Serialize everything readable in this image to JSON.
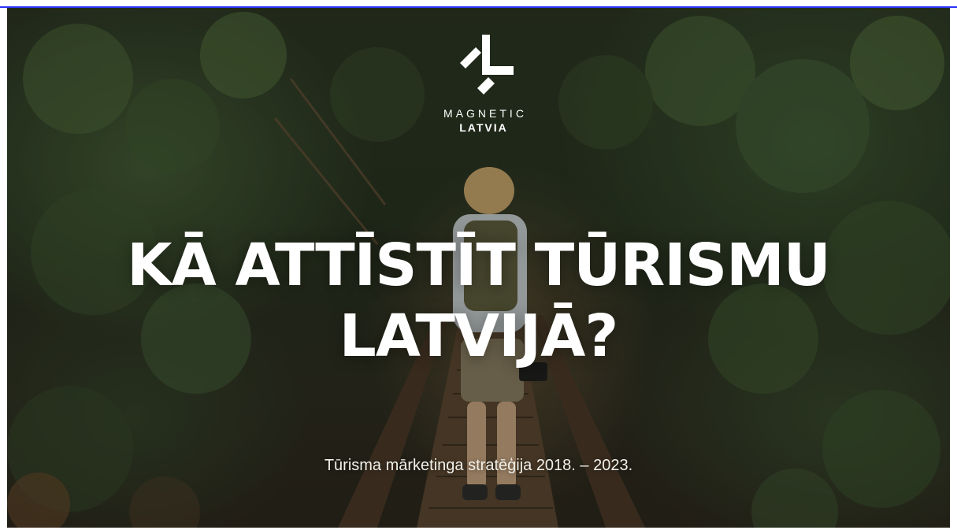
{
  "logo": {
    "name": "logo-mark-icon",
    "word_top": "MAGNETIC",
    "word_bottom": "LATVIA"
  },
  "slide": {
    "headline_line1": "KĀ ATTĪSTĪT TŪRISMU",
    "headline_line2": "LATVIJĀ?",
    "subtitle": "Tūrisma mārketinga stratēģija 2018. – 2023."
  },
  "colors": {
    "frame_accent": "#2b34f5",
    "text": "#ffffff",
    "forest": "#2a3322"
  }
}
